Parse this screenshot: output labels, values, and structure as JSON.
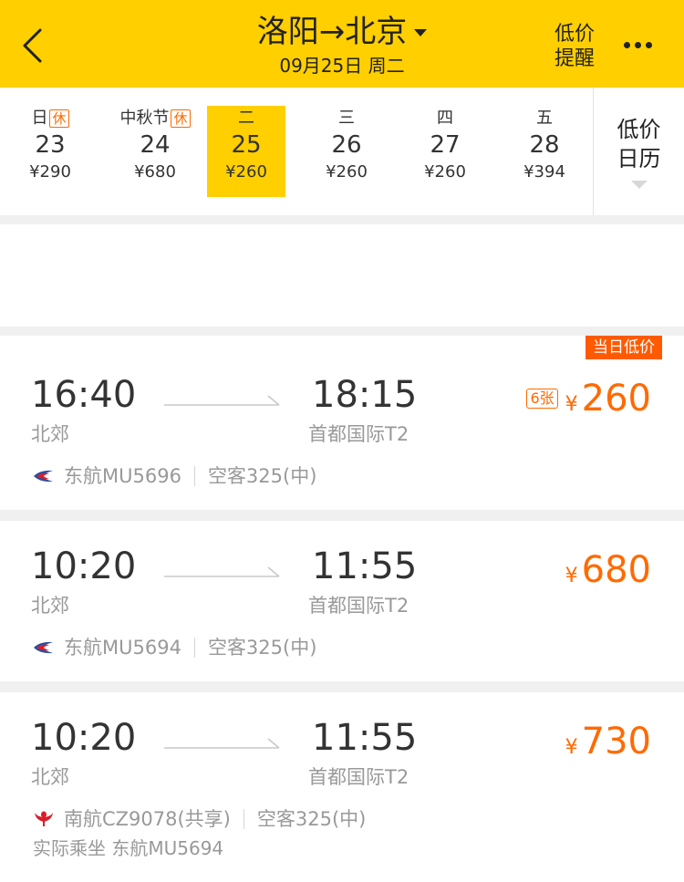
{
  "header": {
    "title": "洛阳→北京",
    "subtitle": "09月25日 周二",
    "alert_line1": "低价",
    "alert_line2": "提醒"
  },
  "dates": [
    {
      "week": "日",
      "rest": "休",
      "day": "23",
      "price": "¥290",
      "selected": false
    },
    {
      "week": "中秋节",
      "rest": "休",
      "day": "24",
      "price": "¥680",
      "selected": false
    },
    {
      "week": "二",
      "rest": "",
      "day": "25",
      "price": "¥260",
      "selected": true
    },
    {
      "week": "三",
      "rest": "",
      "day": "26",
      "price": "¥260",
      "selected": false
    },
    {
      "week": "四",
      "rest": "",
      "day": "27",
      "price": "¥260",
      "selected": false
    },
    {
      "week": "五",
      "rest": "",
      "day": "28",
      "price": "¥394",
      "selected": false
    }
  ],
  "calendar": {
    "line1": "低价",
    "line2": "日历"
  },
  "flights": [
    {
      "tag": "当日低价",
      "dep_time": "16:40",
      "dep_airport": "北郊",
      "arr_time": "18:15",
      "arr_airport": "首都国际T2",
      "tickets": "6张",
      "currency": "¥",
      "price": "260",
      "airline": "东航MU5696",
      "aircraft": "空客325(中)",
      "note": ""
    },
    {
      "tag": "",
      "dep_time": "10:20",
      "dep_airport": "北郊",
      "arr_time": "11:55",
      "arr_airport": "首都国际T2",
      "tickets": "",
      "currency": "¥",
      "price": "680",
      "airline": "东航MU5694",
      "aircraft": "空客325(中)",
      "note": ""
    },
    {
      "tag": "",
      "dep_time": "10:20",
      "dep_airport": "北郊",
      "arr_time": "11:55",
      "arr_airport": "首都国际T2",
      "tickets": "",
      "currency": "¥",
      "price": "730",
      "airline": "南航CZ9078(共享)",
      "aircraft": "空客325(中)",
      "note": "实际乘坐 东航MU5694"
    }
  ],
  "colors": {
    "brand": "#ffcf00",
    "accent": "#ff6a00",
    "tag": "#ff5a00"
  }
}
